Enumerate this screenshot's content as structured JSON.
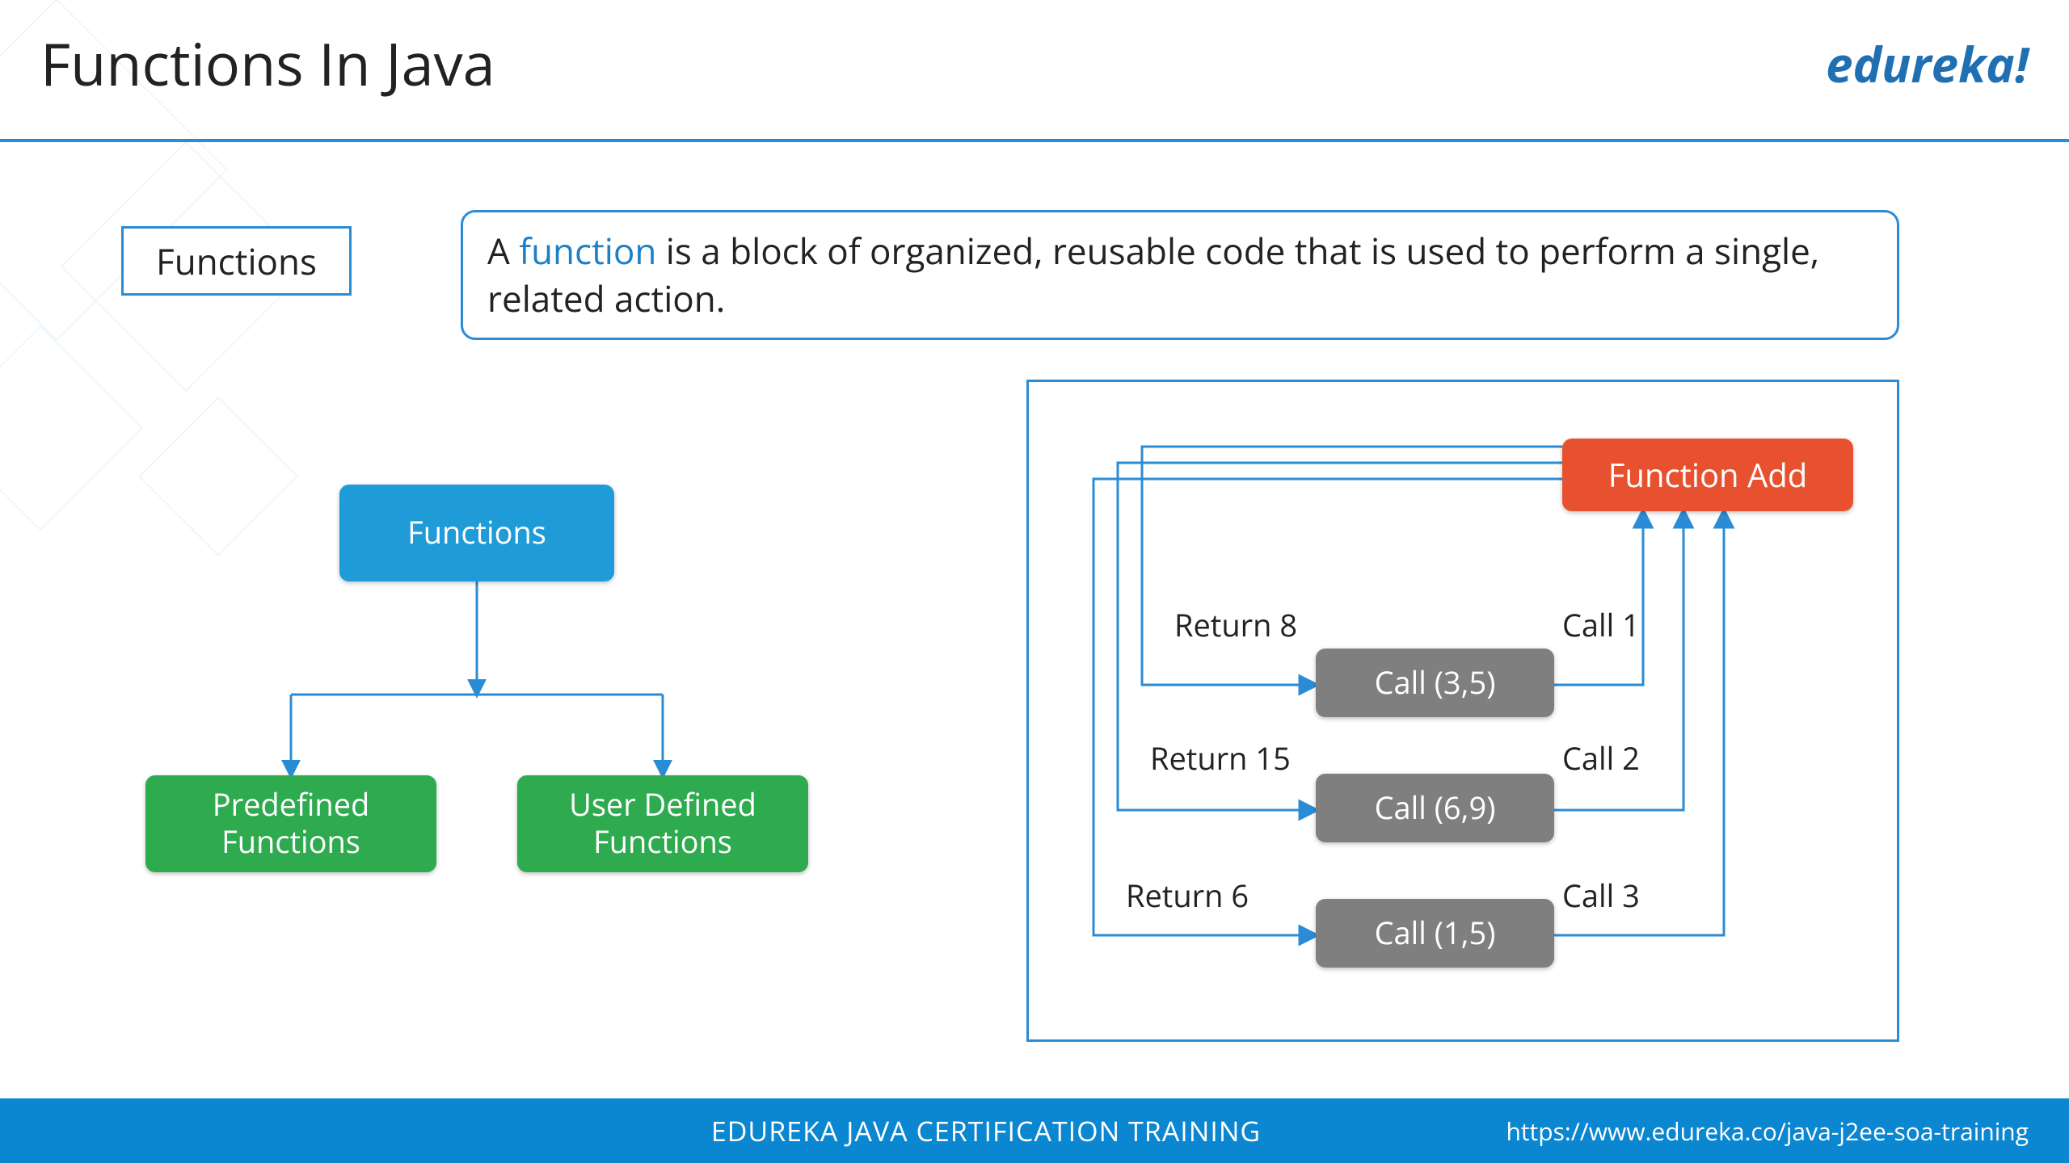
{
  "header": {
    "title": "Functions In Java",
    "brand": "edureka!"
  },
  "badge": {
    "label": "Functions"
  },
  "definition": {
    "prefix": "A ",
    "keyword": "function",
    "suffix": " is a block of organized, reusable code that is used to perform a single, related action."
  },
  "tree": {
    "root": "Functions",
    "left": "Predefined Functions",
    "right": "User Defined Functions"
  },
  "flow": {
    "fn": "Function Add",
    "calls": [
      {
        "box": "Call (3,5)",
        "ret": "Return 8",
        "call": "Call 1"
      },
      {
        "box": "Call (6,9)",
        "ret": "Return 15",
        "call": "Call 2"
      },
      {
        "box": "Call (1,5)",
        "ret": "Return 6",
        "call": "Call 3"
      }
    ]
  },
  "footer": {
    "course": "EDUREKA JAVA CERTIFICATION TRAINING",
    "url": "https://www.edureka.co/java-j2ee-soa-training"
  }
}
